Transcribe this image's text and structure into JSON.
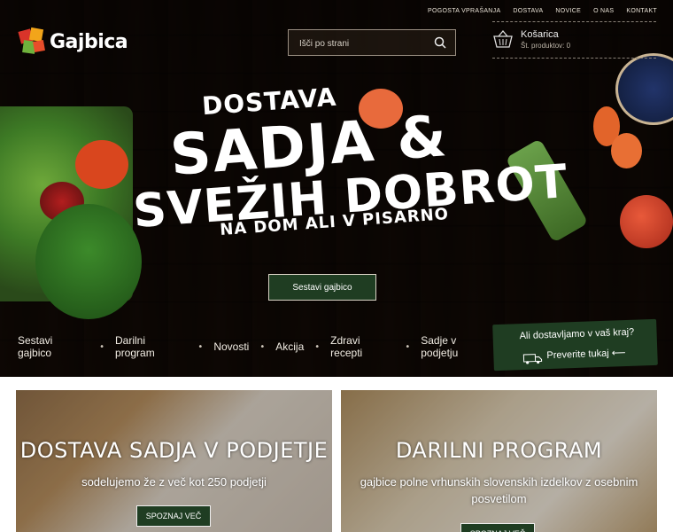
{
  "brand": {
    "name": "Gajbica"
  },
  "topnav": [
    "POGOSTA VPRAŠANJA",
    "DOSTAVA",
    "NOVICE",
    "O NAS",
    "KONTAKT"
  ],
  "search": {
    "placeholder": "Išči po strani"
  },
  "cart": {
    "title": "Košarica",
    "count_label": "Št. produktov: 0"
  },
  "hero": {
    "line1": "DOSTAVA",
    "line2": "SADJA &",
    "line3": "SVEŽIH DOBROT",
    "line4": "NA DOM ALI V PISARNO",
    "cta": "Sestavi gajbico"
  },
  "mainnav": [
    "Sestavi gajbico",
    "Darilni program",
    "Novosti",
    "Akcija",
    "Zdravi recepti",
    "Sadje v podjetju"
  ],
  "delivery": {
    "question": "Ali dostavljamo v vaš kraj?",
    "link": "Preverite tukaj ⟵"
  },
  "cards": [
    {
      "title": "DOSTAVA SADJA V PODJETJE",
      "subtitle": "sodelujemo že z več kot 250 podjetji",
      "button": "SPOZNAJ VEČ"
    },
    {
      "title": "DARILNI PROGRAM",
      "subtitle": "gajbice polne vrhunskih slovenskih izdelkov z osebnim posvetilom",
      "button": "SPOZNAJ VEČ"
    }
  ],
  "colors": {
    "brand_green": "#1f3d22",
    "wood": "#3a2a1e"
  }
}
